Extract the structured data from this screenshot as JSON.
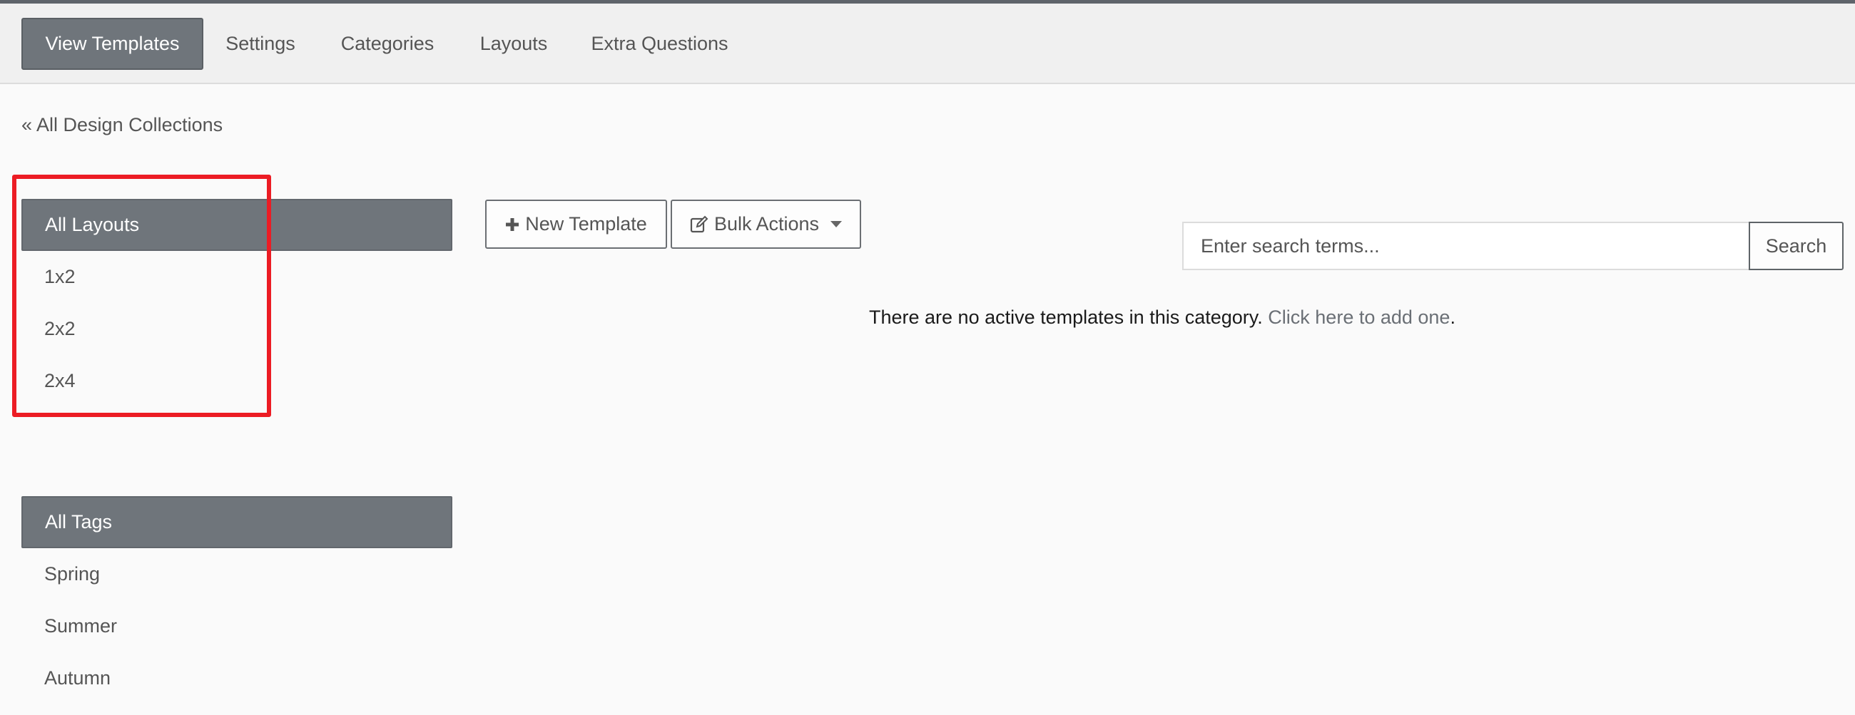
{
  "tabs": [
    {
      "label": "View Templates",
      "active": true
    },
    {
      "label": "Settings"
    },
    {
      "label": "Categories"
    },
    {
      "label": "Layouts"
    },
    {
      "label": "Extra Questions"
    }
  ],
  "breadcrumb": "« All Design Collections",
  "layouts": {
    "header": "All Layouts",
    "items": [
      "1x2",
      "2x2",
      "2x4"
    ]
  },
  "tags": {
    "header": "All Tags",
    "items": [
      "Spring",
      "Summer",
      "Autumn"
    ]
  },
  "toolbar": {
    "new_template": "New Template",
    "bulk_actions": "Bulk Actions"
  },
  "search": {
    "placeholder": "Enter search terms...",
    "button": "Search"
  },
  "empty_state": {
    "message": "There are no active templates in this category.",
    "link": "Click here to add one",
    "suffix": "."
  },
  "colors": {
    "active_bg": "#6f757b",
    "highlight": "#ec1c24"
  }
}
